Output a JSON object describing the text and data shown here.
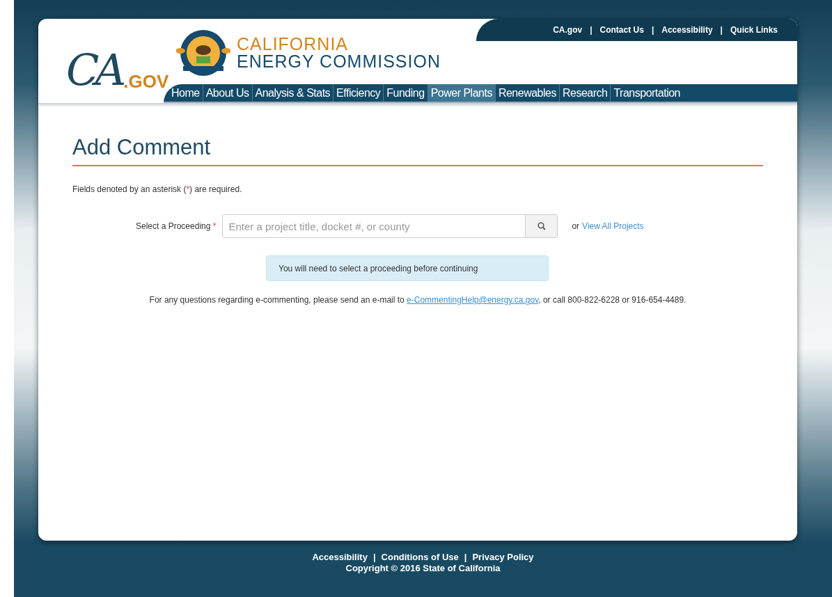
{
  "logo": {
    "ca": "CA",
    "gov": ".GOV"
  },
  "brand": {
    "line1": "CALIFORNIA",
    "line2": "ENERGY COMMISSION"
  },
  "top_links": {
    "separator": "|",
    "items": [
      "CA.gov",
      "Contact Us",
      "Accessibility",
      "Quick Links"
    ]
  },
  "nav": [
    {
      "label": "Home",
      "selected": false
    },
    {
      "label": "About Us",
      "selected": false
    },
    {
      "label": "Analysis & Stats",
      "selected": false
    },
    {
      "label": "Efficiency",
      "selected": false
    },
    {
      "label": "Funding",
      "selected": false
    },
    {
      "label": "Power Plants",
      "selected": true
    },
    {
      "label": "Renewables",
      "selected": false
    },
    {
      "label": "Research",
      "selected": false
    },
    {
      "label": "Transportation",
      "selected": false
    }
  ],
  "page_title": "Add Comment",
  "required_note": {
    "before": "Fields denoted by an asterisk (",
    "asterisk": "*",
    "after": ") are required."
  },
  "proceeding": {
    "label": "Select a Proceeding",
    "asterisk": "*",
    "placeholder": "Enter a project title, docket #, or county",
    "or": "or",
    "link": "View All Projects"
  },
  "alert": "You will need to select a proceeding before continuing",
  "help": {
    "before": "For any questions regarding e-commenting, please send an e-mail to ",
    "link": "e-CommentingHelp@energy.ca.gov",
    "after": ", or call 800-822-6228 or 916-654-4489."
  },
  "footer": {
    "separator": "|",
    "links": [
      "Accessibility",
      "Conditions of Use",
      "Privacy Policy"
    ],
    "copyright": "Copyright © 2016 State of California"
  }
}
